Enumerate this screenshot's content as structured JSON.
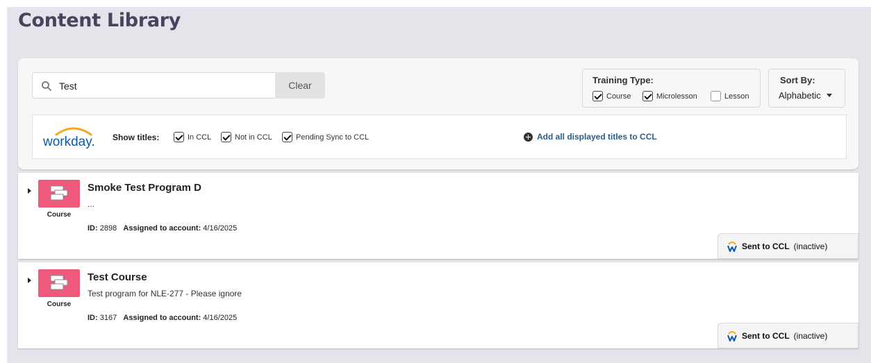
{
  "page": {
    "title": "Content Library"
  },
  "search": {
    "value": "Test",
    "clear_label": "Clear"
  },
  "training_type": {
    "label": "Training Type:",
    "options": [
      {
        "label": "Course",
        "checked": true
      },
      {
        "label": "Microlesson",
        "checked": true
      },
      {
        "label": "Lesson",
        "checked": false
      }
    ]
  },
  "sort": {
    "label": "Sort By:",
    "value": "Alphabetic"
  },
  "ccl_bar": {
    "logo_text": "workday.",
    "show_titles_label": "Show titles:",
    "filters": [
      {
        "label": "In CCL",
        "checked": true
      },
      {
        "label": "Not in CCL",
        "checked": true
      },
      {
        "label": "Pending Sync to CCL",
        "checked": true
      }
    ],
    "add_all_label": "Add all displayed titles to CCL"
  },
  "results": [
    {
      "type": "Course",
      "title": "Smoke Test Program D",
      "description": "...",
      "id_label": "ID:",
      "id": "2898",
      "assigned_label": "Assigned to account:",
      "assigned_date": "4/16/2025",
      "status_bold": "Sent to CCL",
      "status_note": "(inactive)"
    },
    {
      "type": "Course",
      "title": "Test Course",
      "description": "Test program for NLE-277 - Please ignore",
      "id_label": "ID:",
      "id": "3167",
      "assigned_label": "Assigned to account:",
      "assigned_date": "4/16/2025",
      "status_bold": "Sent to CCL",
      "status_note": "(inactive)"
    }
  ],
  "colors": {
    "page_bg": "#e4e4ea",
    "title": "#4a4360",
    "course_thumb": "#ef5a7c",
    "link": "#2c5e8c",
    "workday_blue": "#0b5aa8",
    "workday_orange": "#f5a623"
  }
}
